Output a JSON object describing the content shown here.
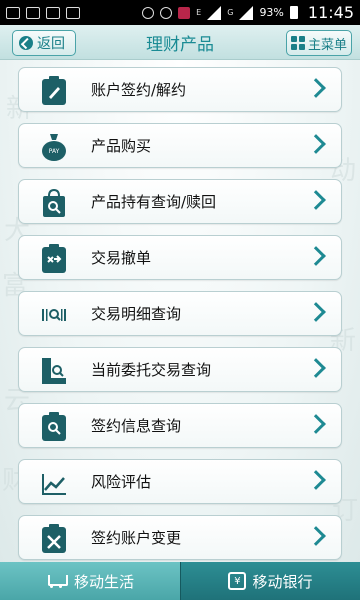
{
  "status_bar": {
    "battery": "93%",
    "time": "11:45",
    "network_label": "G",
    "network_small": "E"
  },
  "header": {
    "back_label": "返回",
    "title": "理财产品",
    "main_menu_label": "主菜单"
  },
  "menu": {
    "items": [
      {
        "label": "账户签约/解约",
        "icon": "clipboard-pen-icon"
      },
      {
        "label": "产品购买",
        "icon": "money-bag-icon"
      },
      {
        "label": "产品持有查询/赎回",
        "icon": "bag-search-icon"
      },
      {
        "label": "交易撤单",
        "icon": "clipboard-shuffle-icon"
      },
      {
        "label": "交易明细查询",
        "icon": "barcode-search-icon"
      },
      {
        "label": "当前委托交易查询",
        "icon": "document-search-icon"
      },
      {
        "label": "签约信息查询",
        "icon": "clipboard-search-icon"
      },
      {
        "label": "风险评估",
        "icon": "line-chart-icon"
      },
      {
        "label": "签约账户变更",
        "icon": "clipboard-tools-icon"
      }
    ]
  },
  "bottom_bar": {
    "tab_life": "移动生活",
    "tab_bank": "移动银行"
  },
  "colors": {
    "accent": "#1a8b94",
    "icon": "#1d5f66",
    "active_tab": "#1f7279"
  }
}
